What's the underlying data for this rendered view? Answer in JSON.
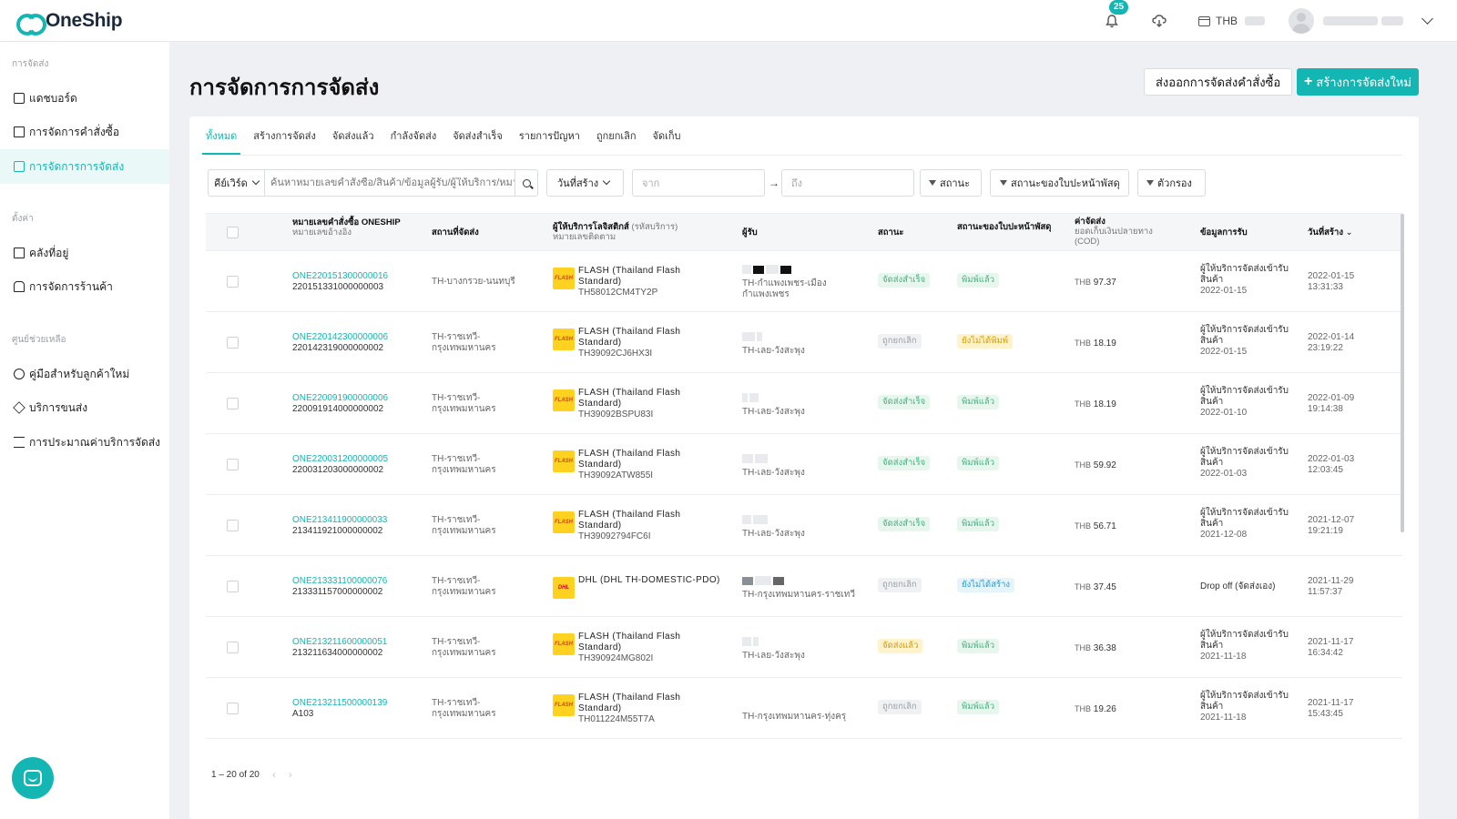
{
  "app": {
    "name": "OneShip"
  },
  "header": {
    "notifications": "25",
    "currency": "THB"
  },
  "sidebar": {
    "sections": [
      {
        "title": "การจัดส่ง"
      },
      {
        "title": "ตั้งค่า"
      },
      {
        "title": "ศูนย์ช่วยเหลือ"
      }
    ],
    "items": [
      {
        "label": "แดชบอร์ด",
        "icon": "dashboard-icon"
      },
      {
        "label": "การจัดการคำสั่งซื้อ",
        "icon": "order-icon"
      },
      {
        "label": "การจัดการการจัดส่ง",
        "icon": "shipment-icon",
        "active": true
      },
      {
        "label": "คลังที่อยู่",
        "icon": "address-book-icon"
      },
      {
        "label": "การจัดการร้านค้า",
        "icon": "shop-icon"
      },
      {
        "label": "คู่มือสำหรับลูกค้าใหม่",
        "icon": "help-icon"
      },
      {
        "label": "บริการขนส่ง",
        "icon": "box-icon"
      },
      {
        "label": "การประมาณค่าบริการจัดส่ง",
        "icon": "calculator-icon"
      }
    ]
  },
  "page": {
    "title": "การจัดการการจัดส่ง",
    "export_label": "ส่งออกการจัดส่งคำสั่งซื้อ",
    "create_label": "สร้างการจัดส่งใหม่"
  },
  "tabs": [
    "ทั้งหมด",
    "สร้างการจัดส่ง",
    "จัดส่งแล้ว",
    "กำลังจัดส่ง",
    "จัดส่งสำเร็จ",
    "รายการปัญหา",
    "ถูกยกเลิก",
    "จัดเก็บ"
  ],
  "filters": {
    "keyword_select": "คีย์เวิร์ด",
    "keyword_placeholder": "ค้นหาหมายเลขคำสั่งซื้อ/สินค้า/ข้อมูลผู้รับ/ผู้ให้บริการ/หมายเลขติดตาม",
    "date_select": "วันที่สร้าง",
    "date_from": "จาก",
    "date_to": "ถึง",
    "status": "สถานะ",
    "parcel_status": "สถานะของใบปะหน้าพัสดุ",
    "more_filters": "ตัวกรอง"
  },
  "table": {
    "headers": {
      "order_no": "หมายเลขคำสั่งซื้อ ONESHIP",
      "order_no_sub": "หมายเลขอ้างอิง",
      "origin": "สถานที่จัดส่ง",
      "carrier": "ผู้ให้บริการโลจิสติกส์",
      "carrier_code": "(รหัสบริการ)",
      "carrier_sub": "หมายเลขติดตาม",
      "receiver": "ผู้รับ",
      "status": "สถานะ",
      "parcel_status": "สถานะของใบปะหน้าพัสดุ",
      "fee": "ค่าจัดส่ง",
      "fee_sub": "ยอดเก็บเงินปลายทาง (COD)",
      "pickup": "ข้อมูลการรับ",
      "created": "วันที่สร้าง"
    },
    "rows": [
      {
        "order": "ONE220151300000016",
        "ref": "220151331000000003",
        "origin": "TH-บางกรวย-นนทบุรี",
        "carrier": "FLASH (Thailand Flash Standard)",
        "carrier_logo": "FLASH",
        "tracking": "TH58012CM4TY2P",
        "receiver": "TH-กำแพงเพชร-เมืองกำแพงเพชร",
        "status": "จัดส่งสำเร็จ",
        "status_color": "green",
        "parcel": "พิมพ์แล้ว",
        "parcel_color": "green",
        "fee_cur": "THB",
        "fee": "97.37",
        "pickup": "ผู้ให้บริการจัดส่งเข้ารับสินค้า",
        "pickup_date": "2022-01-15",
        "created_date": "2022-01-15",
        "created_time": "13:31:33"
      },
      {
        "order": "ONE220142300000006",
        "ref": "220142319000000002",
        "origin": "TH-ราชเทวี-กรุงเทพมหานคร",
        "carrier": "FLASH (Thailand Flash Standard)",
        "carrier_logo": "FLASH",
        "tracking": "TH39092CJ6HX3I",
        "receiver": "TH-เลย-วังสะพุง",
        "status": "ถูกยกเลิก",
        "status_color": "grey",
        "parcel": "ยังไม่ได้พิมพ์",
        "parcel_color": "yellow",
        "fee_cur": "THB",
        "fee": "18.19",
        "pickup": "ผู้ให้บริการจัดส่งเข้ารับสินค้า",
        "pickup_date": "2022-01-15",
        "created_date": "2022-01-14",
        "created_time": "23:19:22"
      },
      {
        "order": "ONE220091900000006",
        "ref": "220091914000000002",
        "origin": "TH-ราชเทวี-กรุงเทพมหานคร",
        "carrier": "FLASH (Thailand Flash Standard)",
        "carrier_logo": "FLASH",
        "tracking": "TH39092BSPU83I",
        "receiver": "TH-เลย-วังสะพุง",
        "status": "จัดส่งสำเร็จ",
        "status_color": "green",
        "parcel": "พิมพ์แล้ว",
        "parcel_color": "green",
        "fee_cur": "THB",
        "fee": "18.19",
        "pickup": "ผู้ให้บริการจัดส่งเข้ารับสินค้า",
        "pickup_date": "2022-01-10",
        "created_date": "2022-01-09",
        "created_time": "19:14:38"
      },
      {
        "order": "ONE220031200000005",
        "ref": "220031203000000002",
        "origin": "TH-ราชเทวี-กรุงเทพมหานคร",
        "carrier": "FLASH (Thailand Flash Standard)",
        "carrier_logo": "FLASH",
        "tracking": "TH39092ATW855I",
        "receiver": "TH-เลย-วังสะพุง",
        "status": "จัดส่งสำเร็จ",
        "status_color": "green",
        "parcel": "พิมพ์แล้ว",
        "parcel_color": "green",
        "fee_cur": "THB",
        "fee": "59.92",
        "pickup": "ผู้ให้บริการจัดส่งเข้ารับสินค้า",
        "pickup_date": "2022-01-03",
        "created_date": "2022-01-03",
        "created_time": "12:03:45"
      },
      {
        "order": "ONE213411900000033",
        "ref": "213411921000000002",
        "origin": "TH-ราชเทวี-กรุงเทพมหานคร",
        "carrier": "FLASH (Thailand Flash Standard)",
        "carrier_logo": "FLASH",
        "tracking": "TH39092794FC6I",
        "receiver": "TH-เลย-วังสะพุง",
        "status": "จัดส่งสำเร็จ",
        "status_color": "green",
        "parcel": "พิมพ์แล้ว",
        "parcel_color": "green",
        "fee_cur": "THB",
        "fee": "56.71",
        "pickup": "ผู้ให้บริการจัดส่งเข้ารับสินค้า",
        "pickup_date": "2021-12-08",
        "created_date": "2021-12-07",
        "created_time": "19:21:19"
      },
      {
        "order": "ONE213331100000076",
        "ref": "213331157000000002",
        "origin": "TH-ราชเทวี-กรุงเทพมหานคร",
        "carrier": "DHL (DHL TH-DOMESTIC-PDO)",
        "carrier_logo": "DHL",
        "tracking": "",
        "receiver": "TH-กรุงเทพมหานคร-ราชเทวี",
        "status": "ถูกยกเลิก",
        "status_color": "grey",
        "parcel": "ยังไม่ได้สร้าง",
        "parcel_color": "blue",
        "fee_cur": "THB",
        "fee": "37.45",
        "pickup": "Drop off (จัดส่งเอง)",
        "pickup_date": "",
        "created_date": "2021-11-29",
        "created_time": "11:57:37"
      },
      {
        "order": "ONE213211600000051",
        "ref": "213211634000000002",
        "origin": "TH-ราชเทวี-กรุงเทพมหานคร",
        "carrier": "FLASH (Thailand Flash Standard)",
        "carrier_logo": "FLASH",
        "tracking": "TH390924MG802I",
        "receiver": "TH-เลย-วังสะพุง",
        "status": "จัดส่งแล้ว",
        "status_color": "yellow",
        "parcel": "พิมพ์แล้ว",
        "parcel_color": "green",
        "fee_cur": "THB",
        "fee": "36.38",
        "pickup": "ผู้ให้บริการจัดส่งเข้ารับสินค้า",
        "pickup_date": "2021-11-18",
        "created_date": "2021-11-17",
        "created_time": "16:34:42"
      },
      {
        "order": "ONE213211500000139",
        "ref": "A103",
        "origin": "TH-ราชเทวี-กรุงเทพมหานคร",
        "carrier": "FLASH (Thailand Flash Standard)",
        "carrier_logo": "FLASH",
        "tracking": "TH011224M55T7A",
        "receiver": "TH-กรุงเทพมหานคร-ทุ่งครุ",
        "status": "ถูกยกเลิก",
        "status_color": "grey",
        "parcel": "พิมพ์แล้ว",
        "parcel_color": "green",
        "fee_cur": "THB",
        "fee": "19.26",
        "pickup": "ผู้ให้บริการจัดส่งเข้ารับสินค้า",
        "pickup_date": "2021-11-18",
        "created_date": "2021-11-17",
        "created_time": "15:43:45"
      }
    ]
  },
  "pagination": {
    "summary": "1 – 20 of 20"
  }
}
